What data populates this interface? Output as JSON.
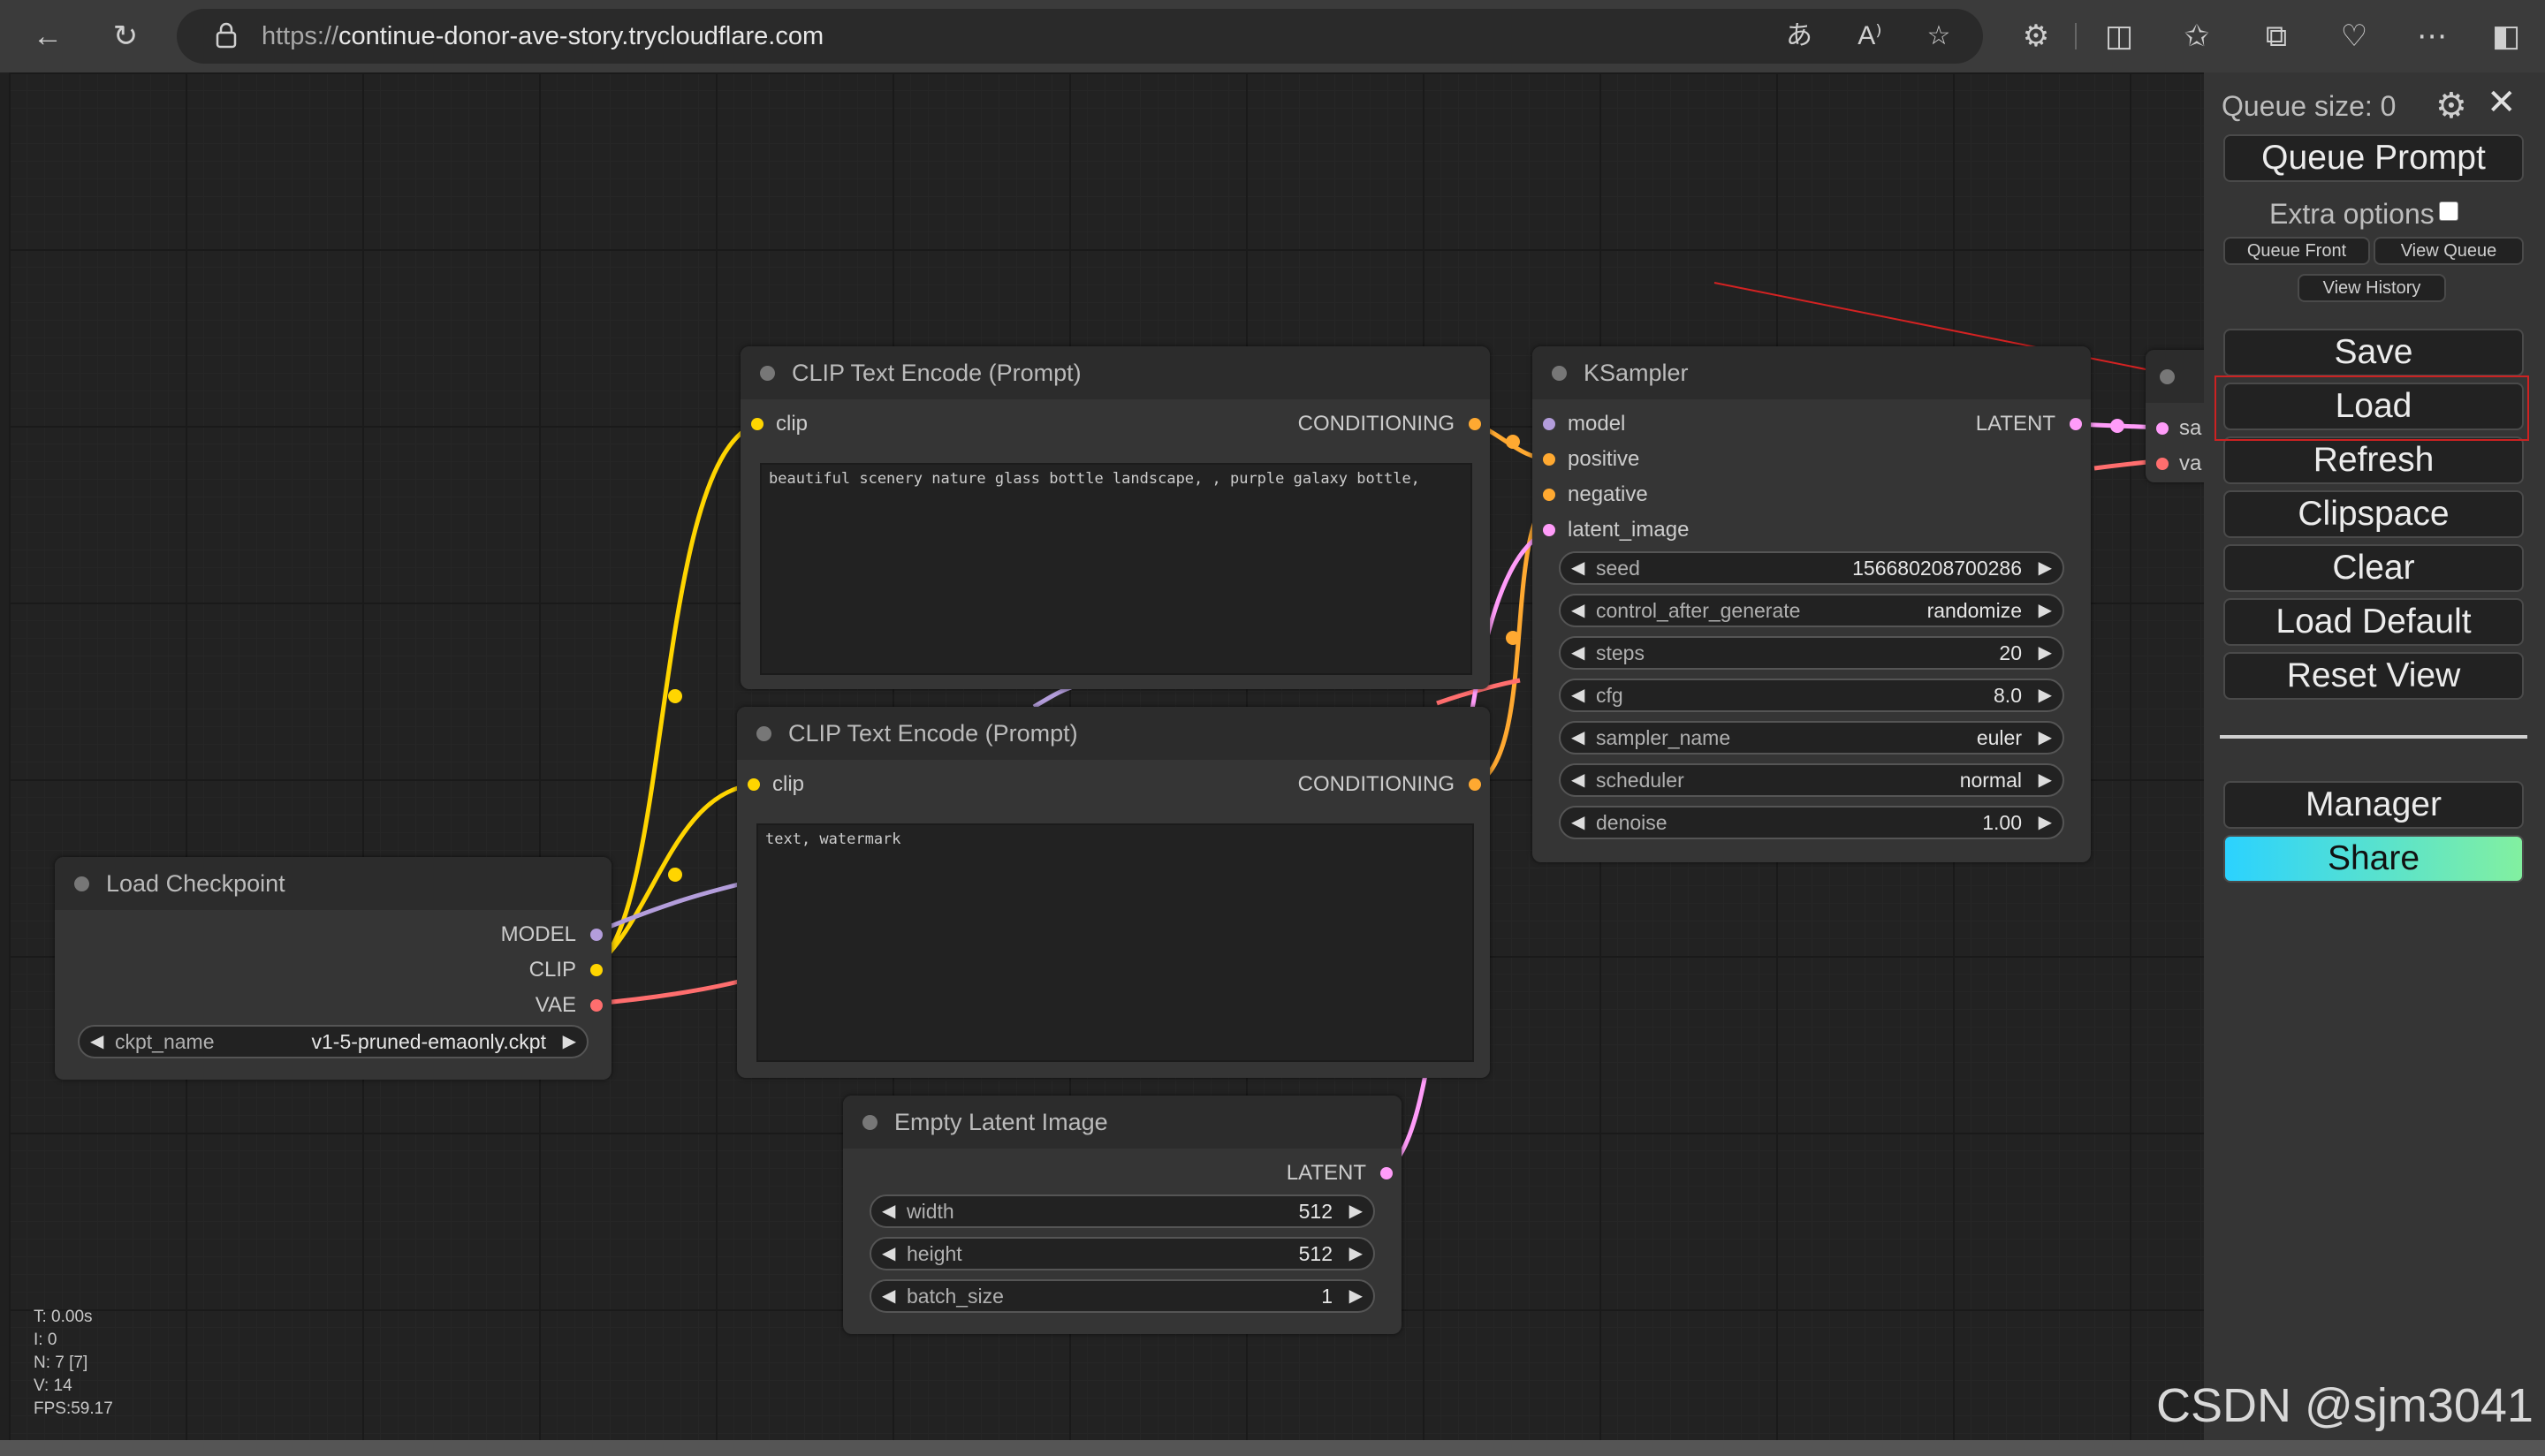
{
  "browser": {
    "url_proto": "https://",
    "url_host": "continue-donor-ave-story.trycloudflare.com",
    "icons": [
      "back-icon",
      "refresh-icon",
      "lock-icon",
      "translate-icon",
      "read-aloud-icon",
      "favorite-star-icon",
      "extensions-icon",
      "split-screen-icon",
      "favorites-icon",
      "collections-icon",
      "performance-icon",
      "more-icon",
      "sidebar-icon"
    ]
  },
  "nodes": {
    "clip_pos": {
      "title": "CLIP Text Encode (Prompt)",
      "input_clip": "clip",
      "output": "CONDITIONING",
      "text": "beautiful scenery nature glass bottle landscape, , purple galaxy bottle,"
    },
    "clip_neg": {
      "title": "CLIP Text Encode (Prompt)",
      "input_clip": "clip",
      "output": "CONDITIONING",
      "text": "text, watermark"
    },
    "ksampler": {
      "title": "KSampler",
      "inputs": [
        "model",
        "positive",
        "negative",
        "latent_image"
      ],
      "output": "LATENT",
      "widgets": [
        {
          "name": "seed",
          "value": "156680208700286"
        },
        {
          "name": "control_after_generate",
          "value": "randomize"
        },
        {
          "name": "steps",
          "value": "20"
        },
        {
          "name": "cfg",
          "value": "8.0"
        },
        {
          "name": "sampler_name",
          "value": "euler"
        },
        {
          "name": "scheduler",
          "value": "normal"
        },
        {
          "name": "denoise",
          "value": "1.00"
        }
      ]
    },
    "checkpoint": {
      "title": "Load Checkpoint",
      "outputs": [
        "MODEL",
        "CLIP",
        "VAE"
      ],
      "widget": {
        "name": "ckpt_name",
        "value": "v1-5-pruned-emaonly.ckpt"
      }
    },
    "latent": {
      "title": "Empty Latent Image",
      "output": "LATENT",
      "widgets": [
        {
          "name": "width",
          "value": "512"
        },
        {
          "name": "height",
          "value": "512"
        },
        {
          "name": "batch_size",
          "value": "1"
        }
      ]
    },
    "vae_decode": {
      "inputs": [
        "sa",
        "va"
      ]
    }
  },
  "menu": {
    "queue_size": "Queue size: 0",
    "queue_prompt": "Queue Prompt",
    "extra_options": "Extra options",
    "queue_front": "Queue Front",
    "view_queue": "View Queue",
    "view_history": "View History",
    "save": "Save",
    "load": "Load",
    "refresh": "Refresh",
    "clipspace": "Clipspace",
    "clear": "Clear",
    "load_default": "Load Default",
    "reset_view": "Reset View",
    "manager": "Manager",
    "share": "Share"
  },
  "stats": [
    "T: 0.00s",
    "I: 0",
    "N: 7 [7]",
    "V: 14",
    "FPS:59.17"
  ],
  "watermark": "CSDN @sjm3041",
  "colors": {
    "clip": "#ffd500",
    "model": "#b39ddb",
    "vae": "#ff6e6e",
    "conditioning": "#ffa931",
    "latent": "#ff9cf9",
    "share_gradient_start": "#2bd2ff",
    "share_gradient_end": "#82f0a0"
  }
}
